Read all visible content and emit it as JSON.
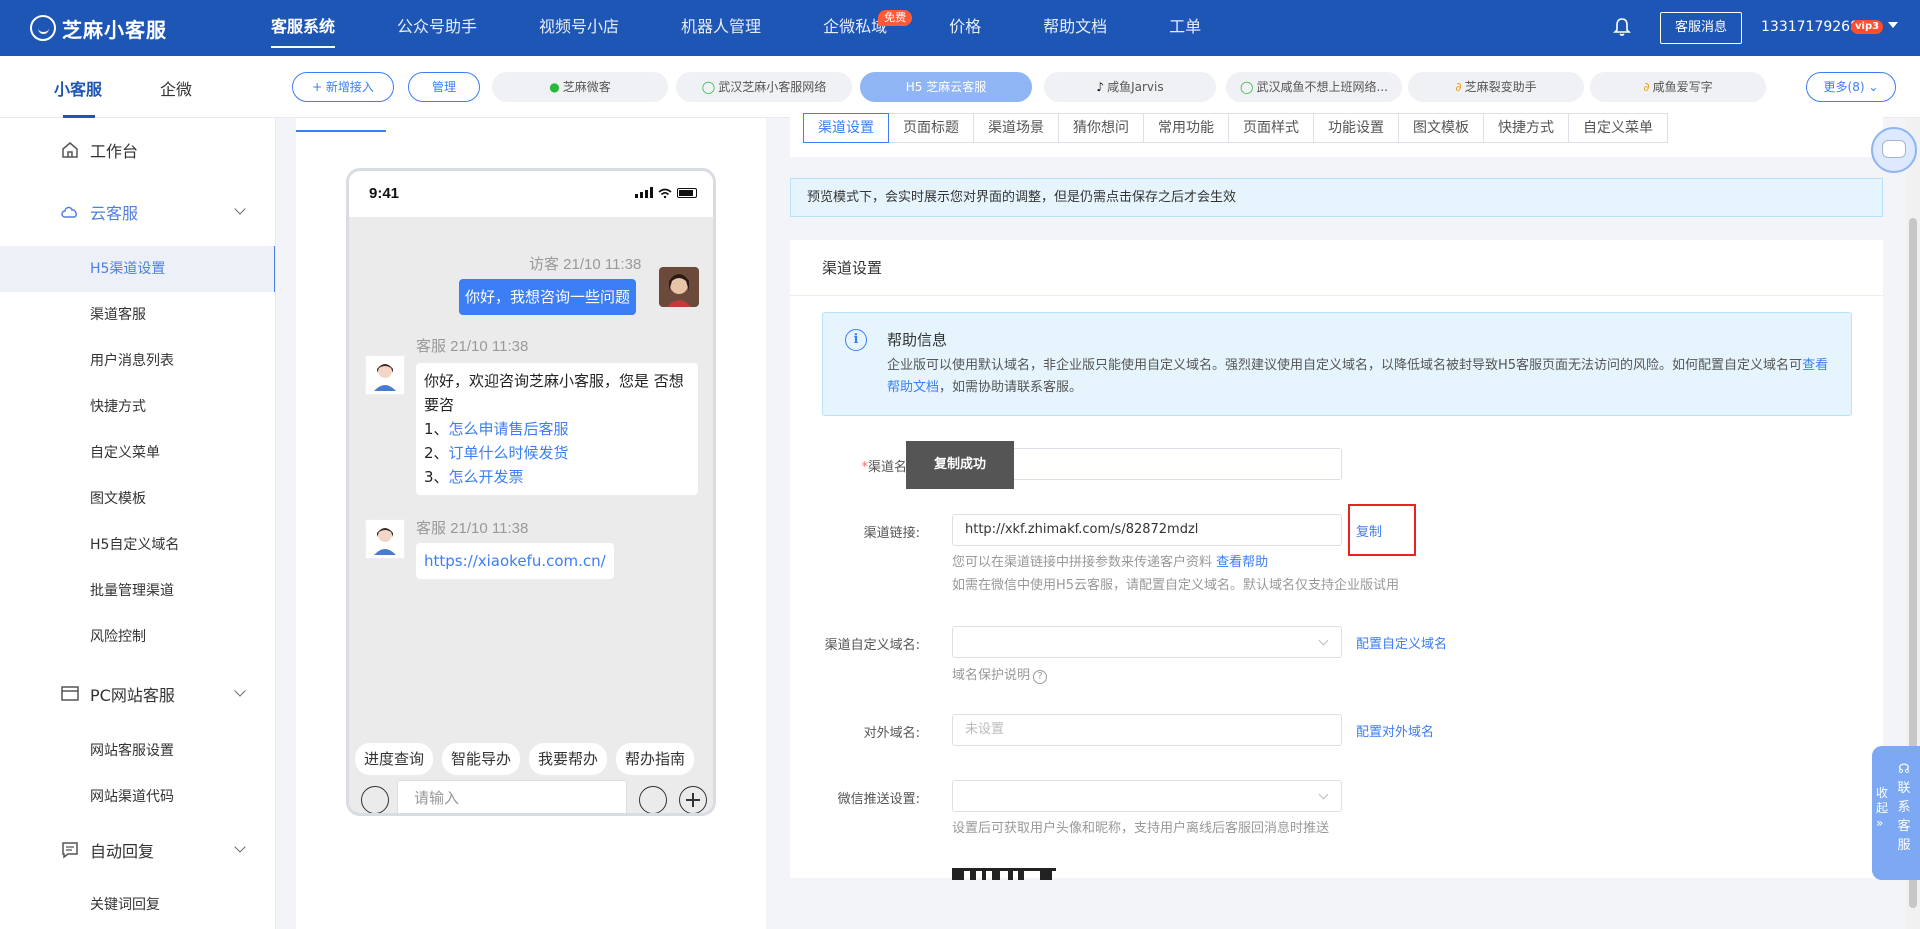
{
  "brand": {
    "name": "芝麻小客服"
  },
  "topnav": {
    "items": [
      "客服系统",
      "公众号助手",
      "视频号小店",
      "机器人管理",
      "企微私域",
      "价格",
      "帮助文档",
      "工单"
    ],
    "free_badge": "免费",
    "service_msg": "客服消息",
    "phone": "13317179268",
    "vip": "vip3"
  },
  "subbar": {
    "tabs": [
      "小客服",
      "企微"
    ],
    "add_btn": "+ 新增接入",
    "manage_btn": "管理",
    "channels": [
      {
        "label": "芝麻微客",
        "icon": "wechat"
      },
      {
        "label": "武汉芝麻小客服网络",
        "icon": "whatsapp"
      },
      {
        "label": "H5 芝麻云客服",
        "icon": "none"
      },
      {
        "label": "咸鱼Jarvis",
        "icon": "douyin"
      },
      {
        "label": "武汉咸鱼不想上班网络...",
        "icon": "whatsapp"
      },
      {
        "label": "芝麻裂变助手",
        "icon": "link"
      },
      {
        "label": "咸鱼爱写字",
        "icon": "link"
      }
    ],
    "more_btn": "更多(8)"
  },
  "sidebar": {
    "workbench": "工作台",
    "cloud": "云客服",
    "cloud_items": [
      "H5渠道设置",
      "渠道客服",
      "用户消息列表",
      "快捷方式",
      "自定义菜单",
      "图文模板",
      "H5自定义域名",
      "批量管理渠道",
      "风险控制"
    ],
    "pc": "PC网站客服",
    "pc_items": [
      "网站客服设置",
      "网站渠道代码"
    ],
    "auto": "自动回复",
    "auto_items": [
      "关键词回复"
    ]
  },
  "phone": {
    "time": "9:41",
    "msg1_meta": "访客 21/10 11:38",
    "msg1_text": "你好，我想咨询一些问题",
    "msg2_meta": "客服 21/10 11:38",
    "msg2_line1": "你好，欢迎咨询芝麻小客服，您是 否想要咨",
    "msg2_opt1_num": "1、",
    "msg2_opt1": "怎么申请售后客服",
    "msg2_opt2_num": "2、",
    "msg2_opt2": "订单什么时候发货",
    "msg2_opt3_num": "3、",
    "msg2_opt3": "怎么开发票",
    "msg3_meta": "客服 21/10 11:38",
    "msg3_link": "https://xiaokefu.com.cn/",
    "quick": [
      "进度查询",
      "智能导办",
      "我要帮办",
      "帮办指南"
    ],
    "input_placeholder": "请输入"
  },
  "config": {
    "tabs": [
      "渠道设置",
      "页面标题",
      "渠道场景",
      "猜你想问",
      "常用功能",
      "页面样式",
      "功能设置",
      "图文模板",
      "快捷方式",
      "自定义菜单"
    ],
    "notice": "预览模式下，会实时展示您对界面的调整，但是仍需点击保存之后才会生效",
    "card_title": "渠道设置",
    "help_title": "帮助信息",
    "help_body_1": "企业版可以使用默认域名，非企业版只能使用自定义域名。强烈建议使用自定义域名，以降低域名被封导致H5客服页面无法访问的风险。如何配置自定义域名可",
    "help_body_link": "查看帮助文档",
    "help_body_2": "，如需协助请联系客服。",
    "name_label": "渠道名称",
    "link_label": "渠道链接:",
    "link_value": "http://xkf.zhimakf.com/s/82872mdzl",
    "copy": "复制",
    "link_hint_1": "您可以在渠道链接中拼接参数来传递客户资料",
    "link_hint_link": "查看帮助",
    "link_hint_2": "如需在微信中使用H5云客服，请配置自定义域名。默认域名仅支持企业版试用",
    "domain_label": "渠道自定义域名:",
    "domain_link": "配置自定义域名",
    "domain_hint": "域名保护说明",
    "external_label": "对外域名:",
    "external_placeholder": "未设置",
    "external_link": "配置对外域名",
    "wx_label": "微信推送设置:",
    "wx_hint": "设置后可获取用户头像和昵称，支持用户离线后客服回消息时推送",
    "toast": "复制成功"
  },
  "float": {
    "collapse": "收起",
    "contact": "联系客服"
  },
  "colors": {
    "primary": "#1e56b6",
    "accent": "#3b7ef6",
    "danger": "#e62222"
  }
}
